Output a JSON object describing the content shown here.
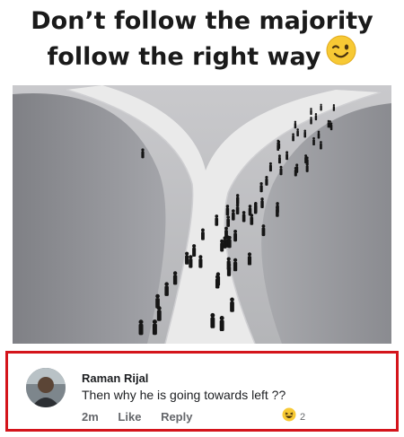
{
  "caption": {
    "line1": "Don’t follow the majority",
    "line2": "follow the right way",
    "emoji_icon": "winking-face-icon"
  },
  "photo": {
    "description_icon": "crowd-at-fork-road-image",
    "colors": {
      "wall": "#8e8e92",
      "path": "#e9e9e9",
      "figures": "#161616"
    }
  },
  "comment": {
    "author": "Raman Rijal",
    "text": "Then why he is going towards left ??",
    "time": "2m",
    "like_label": "Like",
    "reply_label": "Reply",
    "reaction_icon": "haha-reaction-icon",
    "reaction_count": "2",
    "highlight_color": "#d4141b"
  }
}
